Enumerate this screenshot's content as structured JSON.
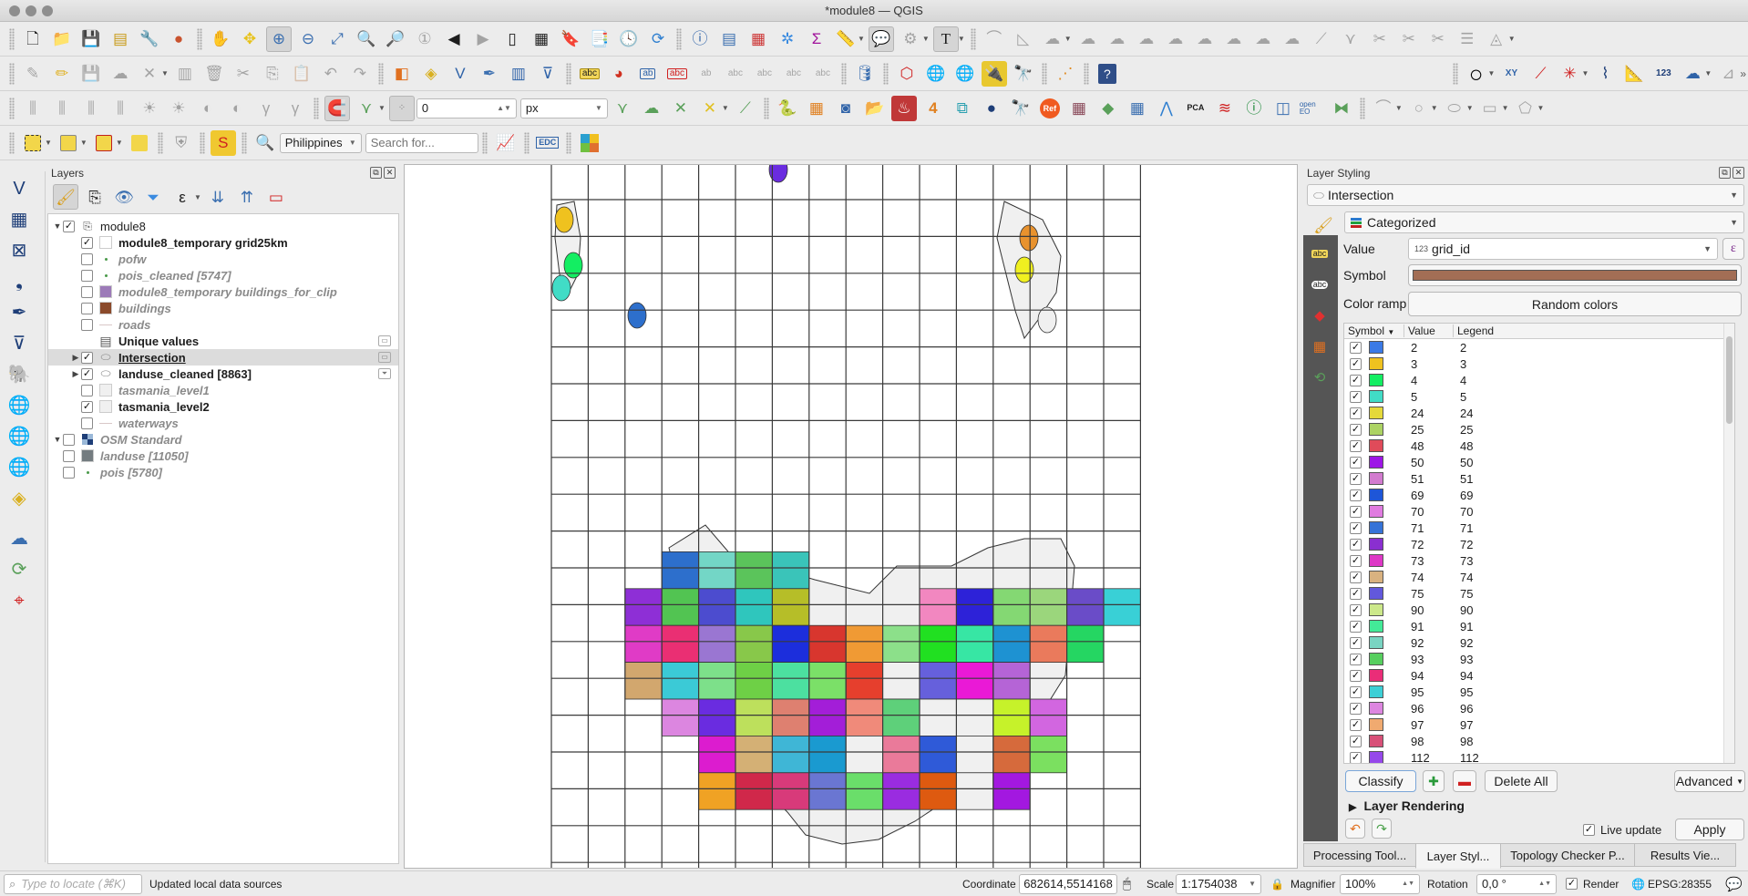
{
  "window": {
    "title": "*module8 — QGIS"
  },
  "toolbar": {
    "row1": [
      "new-project",
      "open-project",
      "save-project",
      "new-print-layout",
      "layout-manager",
      "style-manager",
      "pan",
      "pan-to-selection",
      "zoom-in",
      "zoom-out",
      "zoom-full",
      "zoom-to-selection",
      "zoom-to-layer",
      "zoom-native",
      "zoom-last",
      "zoom-next",
      "new-bookmark",
      "show-bookmarks",
      "new-spatial-bookmark",
      "show-spatial-bookmarks",
      "temporal-controller",
      "refresh",
      "identify",
      "open-attribute-table",
      "statistical-summary",
      "processing-toolbox",
      "field-calculator",
      "measure",
      "map-tips",
      "annotation",
      "text-annotation"
    ],
    "snap_tolerance_value": "0",
    "snap_unit": "px",
    "locator_country": "Philippines",
    "search_placeholder": "Search for...",
    "plugin_edc_label": "EDC",
    "plugin_pca_label": "PCA",
    "plugin_openeo_label": "open EO",
    "plugin_ref_label": "Ref",
    "plugin_123_label": "123",
    "plugin_xy_label": "XY"
  },
  "layers_panel": {
    "title": "Layers",
    "items": [
      {
        "name": "module8",
        "type": "group",
        "checked": true,
        "expanded": true,
        "style": "normal"
      },
      {
        "name": "module8_temporary grid25km",
        "checked": true,
        "style": "bold",
        "symbol": "#ffffff"
      },
      {
        "name": "pofw",
        "checked": false,
        "style": "italic",
        "symbol": "point"
      },
      {
        "name": "pois_cleaned [5747]",
        "checked": false,
        "style": "italic",
        "symbol": "point"
      },
      {
        "name": "module8_temporary buildings_for_clip",
        "checked": false,
        "style": "italic",
        "symbol": "#9c7ab8"
      },
      {
        "name": "buildings",
        "checked": false,
        "style": "italic",
        "symbol": "#8b4a2b"
      },
      {
        "name": "roads",
        "checked": false,
        "style": "italic",
        "symbol": "line"
      },
      {
        "name": "Unique values",
        "type": "table",
        "style": "bold"
      },
      {
        "name": "Intersection",
        "checked": true,
        "style": "bold-underline",
        "selected": true,
        "symbol": "polygon"
      },
      {
        "name": "landuse_cleaned [8863]",
        "checked": true,
        "style": "bold",
        "symbol": "polygon"
      },
      {
        "name": "tasmania_level1",
        "checked": false,
        "style": "italic",
        "symbol": "#f0f0f0"
      },
      {
        "name": "tasmania_level2",
        "checked": true,
        "style": "bold",
        "symbol": "#f0f0f0"
      },
      {
        "name": "waterways",
        "checked": false,
        "style": "italic",
        "symbol": "line"
      },
      {
        "name": "OSM Standard",
        "type": "group",
        "checked": false,
        "style": "italic",
        "symbol": "raster"
      },
      {
        "name": "landuse [11050]",
        "checked": false,
        "style": "italic",
        "symbol": "#747c80"
      },
      {
        "name": "pois [5780]",
        "checked": false,
        "style": "italic",
        "symbol": "point"
      }
    ]
  },
  "styling_panel": {
    "title": "Layer Styling",
    "layer": "Intersection",
    "renderer": "Categorized",
    "value_label": "Value",
    "value_field": "grid_id",
    "value_type_badge": "123",
    "symbol_label": "Symbol",
    "symbol_color": "#a36e55",
    "color_ramp_label": "Color ramp",
    "color_ramp": "Random colors",
    "columns": [
      "Symbol",
      "Value",
      "Legend"
    ],
    "categories": [
      {
        "value": "2",
        "legend": "2",
        "color": "#3b7ae6"
      },
      {
        "value": "3",
        "legend": "3",
        "color": "#efc21f"
      },
      {
        "value": "4",
        "legend": "4",
        "color": "#13ee62"
      },
      {
        "value": "5",
        "legend": "5",
        "color": "#41dcc6"
      },
      {
        "value": "24",
        "legend": "24",
        "color": "#e5d93a"
      },
      {
        "value": "25",
        "legend": "25",
        "color": "#acd363"
      },
      {
        "value": "48",
        "legend": "48",
        "color": "#e04b5a"
      },
      {
        "value": "50",
        "legend": "50",
        "color": "#9d16e6"
      },
      {
        "value": "51",
        "legend": "51",
        "color": "#d27bcf"
      },
      {
        "value": "69",
        "legend": "69",
        "color": "#1e56d8"
      },
      {
        "value": "70",
        "legend": "70",
        "color": "#e07be0"
      },
      {
        "value": "71",
        "legend": "71",
        "color": "#3673d8"
      },
      {
        "value": "72",
        "legend": "72",
        "color": "#8a2fd0"
      },
      {
        "value": "73",
        "legend": "73",
        "color": "#de38c6"
      },
      {
        "value": "74",
        "legend": "74",
        "color": "#d9b280"
      },
      {
        "value": "75",
        "legend": "75",
        "color": "#6258dc"
      },
      {
        "value": "90",
        "legend": "90",
        "color": "#cce88a"
      },
      {
        "value": "91",
        "legend": "91",
        "color": "#43ea98"
      },
      {
        "value": "92",
        "legend": "92",
        "color": "#79d4c2"
      },
      {
        "value": "93",
        "legend": "93",
        "color": "#57cf5f"
      },
      {
        "value": "94",
        "legend": "94",
        "color": "#ea2d78"
      },
      {
        "value": "95",
        "legend": "95",
        "color": "#3dcfd6"
      },
      {
        "value": "96",
        "legend": "96",
        "color": "#dd86e0"
      },
      {
        "value": "97",
        "legend": "97",
        "color": "#f0aa70"
      },
      {
        "value": "98",
        "legend": "98",
        "color": "#d85078"
      },
      {
        "value": "112",
        "legend": "112",
        "color": "#9648ea"
      }
    ],
    "classify": "Classify",
    "delete_all": "Delete All",
    "advanced": "Advanced",
    "layer_rendering": "Layer Rendering",
    "live_update": "Live update",
    "live_update_checked": true,
    "apply": "Apply"
  },
  "dock_tabs": [
    {
      "label": "Processing Tool...",
      "active": false
    },
    {
      "label": "Layer Styl...",
      "active": true
    },
    {
      "label": "Topology Checker P...",
      "active": false
    },
    {
      "label": "Results Vie...",
      "active": false
    }
  ],
  "statusbar": {
    "locator_placeholder": "Type to locate (⌘K)",
    "message": "Updated local data sources",
    "coordinate_label": "Coordinate",
    "coordinate": "682614,5514168",
    "scale_label": "Scale",
    "scale": "1:1754038",
    "magnifier_label": "Magnifier",
    "magnifier": "100%",
    "rotation_label": "Rotation",
    "rotation": "0,0 °",
    "render_label": "Render",
    "render_checked": true,
    "crs": "EPSG:28355"
  },
  "map": {
    "grid": {
      "columns": 16,
      "rows": 19
    },
    "cells": [
      [
        1,
        11,
        "#2d6fcc"
      ],
      [
        2,
        11,
        "#73d6c6"
      ],
      [
        3,
        11,
        "#5bc45b"
      ],
      [
        4,
        11,
        "#3ac4b9"
      ],
      [
        0,
        12,
        "#8e2fd6"
      ],
      [
        1,
        12,
        "#52c452"
      ],
      [
        2,
        12,
        "#4c4ccf"
      ],
      [
        3,
        12,
        "#2fc6bd"
      ],
      [
        4,
        12,
        "#b6be28"
      ],
      [
        8,
        12,
        "#f287c0"
      ],
      [
        9,
        12,
        "#2d22d8"
      ],
      [
        10,
        12,
        "#84d873"
      ],
      [
        11,
        12,
        "#9bd67c"
      ],
      [
        12,
        12,
        "#6a4cc8"
      ],
      [
        13,
        12,
        "#39d0d6"
      ],
      [
        0,
        13,
        "#e03bc6"
      ],
      [
        1,
        13,
        "#ea2f73"
      ],
      [
        2,
        13,
        "#9a76d2"
      ],
      [
        3,
        13,
        "#88c84a"
      ],
      [
        4,
        13,
        "#1c2edc"
      ],
      [
        5,
        13,
        "#d8362e"
      ],
      [
        6,
        13,
        "#f09a34"
      ],
      [
        7,
        13,
        "#8ce08a"
      ],
      [
        8,
        13,
        "#21e021"
      ],
      [
        9,
        13,
        "#37e6a4"
      ],
      [
        10,
        13,
        "#1e92d2"
      ],
      [
        11,
        13,
        "#ea7a5c"
      ],
      [
        12,
        13,
        "#25d662"
      ],
      [
        0,
        14,
        "#d2a76e"
      ],
      [
        1,
        14,
        "#3bcad6"
      ],
      [
        2,
        14,
        "#7de08a"
      ],
      [
        3,
        14,
        "#6ed046"
      ],
      [
        4,
        14,
        "#4ce0a0"
      ],
      [
        5,
        14,
        "#7be068"
      ],
      [
        6,
        14,
        "#e63f2d"
      ],
      [
        7,
        14,
        "#f0f0f0"
      ],
      [
        8,
        14,
        "#6660dc"
      ],
      [
        9,
        14,
        "#ea19d6"
      ],
      [
        10,
        14,
        "#b564d6"
      ],
      [
        1,
        15,
        "#dc86e0"
      ],
      [
        2,
        15,
        "#6a2ce0"
      ],
      [
        3,
        15,
        "#bde05c"
      ],
      [
        4,
        15,
        "#de8070"
      ],
      [
        5,
        15,
        "#a31ed8"
      ],
      [
        6,
        15,
        "#f08a7a"
      ],
      [
        7,
        15,
        "#5ed07a"
      ],
      [
        8,
        15,
        "#f0f0f0"
      ],
      [
        9,
        15,
        "#f0f0f0"
      ],
      [
        10,
        15,
        "#c6f22a"
      ],
      [
        11,
        15,
        "#d266e0"
      ],
      [
        2,
        16,
        "#dc1ccf"
      ],
      [
        3,
        16,
        "#d4b075"
      ],
      [
        4,
        16,
        "#3fb6d6"
      ],
      [
        5,
        16,
        "#1a9ad0"
      ],
      [
        6,
        16,
        "#f0f0f0"
      ],
      [
        7,
        16,
        "#ea7a9a"
      ],
      [
        8,
        16,
        "#2f5ad8"
      ],
      [
        9,
        16,
        "#f0f0f0"
      ],
      [
        10,
        16,
        "#d66a3c"
      ],
      [
        11,
        16,
        "#7be060"
      ],
      [
        2,
        17,
        "#f0a224"
      ],
      [
        3,
        17,
        "#d0284a"
      ],
      [
        4,
        17,
        "#d83a7a"
      ],
      [
        5,
        17,
        "#6a76d2"
      ],
      [
        6,
        17,
        "#6ade6a"
      ],
      [
        7,
        17,
        "#9a2ce0"
      ],
      [
        8,
        17,
        "#de5a10"
      ],
      [
        9,
        17,
        "#f0f0f0"
      ],
      [
        10,
        17,
        "#a318e0"
      ]
    ]
  }
}
